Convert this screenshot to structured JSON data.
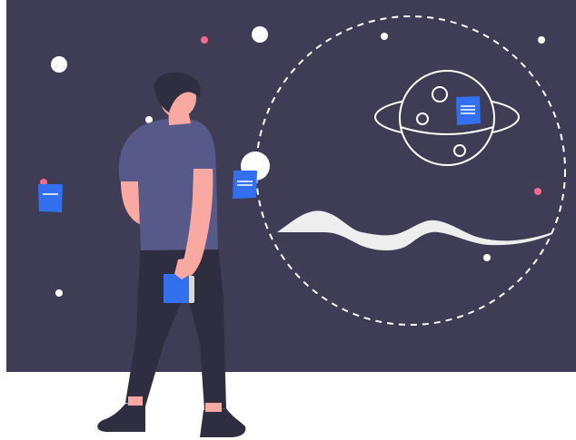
{
  "colors": {
    "background": "#ffffff",
    "board": "#3f3d56",
    "skin": "#f9a8a2",
    "hair": "#2f2e41",
    "shirt": "#575a89",
    "pants": "#2f2e41",
    "shoes": "#2f2e41",
    "note": "#3370f0",
    "note_line": "#ffffff",
    "star": "#ffffff",
    "accent_dot": "#f76b8a",
    "wave": "#eeeeee",
    "planet_line": "#ffffff",
    "phone_edge": "#d9d9d9"
  },
  "icons": [
    "note-icon",
    "planet-icon",
    "star-icon",
    "wave-icon"
  ]
}
